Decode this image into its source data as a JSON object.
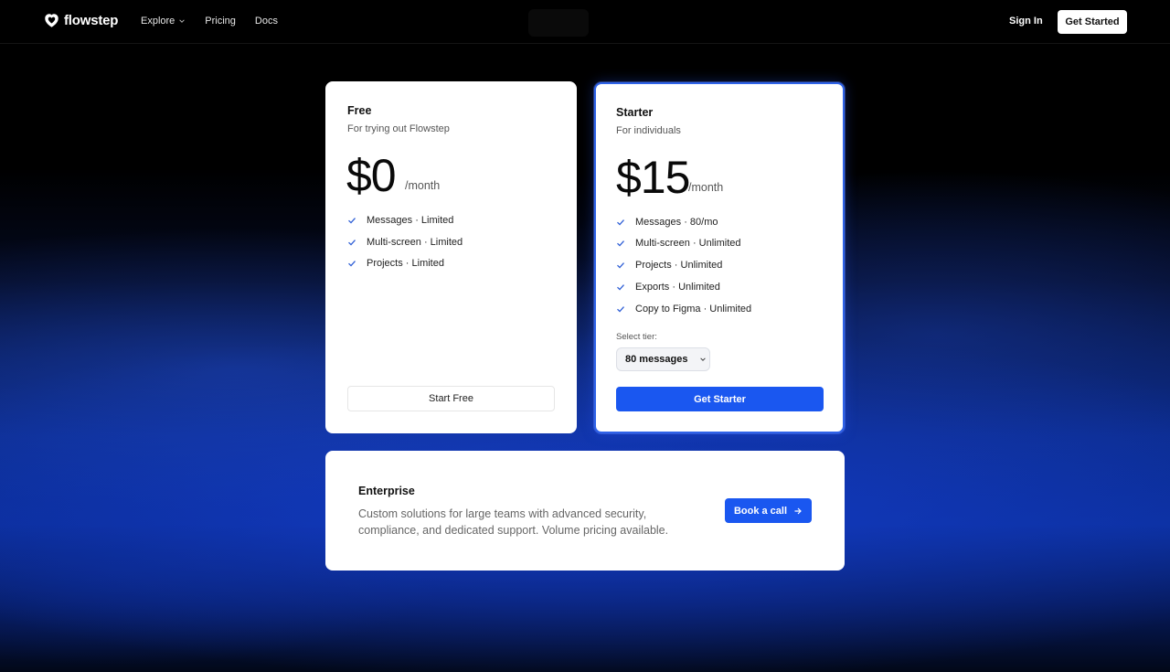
{
  "brand": {
    "name": "flowstep",
    "icon": "heart-shield-icon"
  },
  "nav": {
    "links": [
      {
        "label": "Explore",
        "has_dropdown": true
      },
      {
        "label": "Pricing"
      },
      {
        "label": "Docs"
      }
    ],
    "sign_in": "Sign In",
    "get_started": "Get Started"
  },
  "plans": {
    "free": {
      "name": "Free",
      "description": "For trying out Flowstep",
      "price": "$0",
      "period": "/month",
      "features": [
        "Messages · Limited",
        "Multi-screen · Limited",
        "Projects · Limited"
      ],
      "cta": "Start Free"
    },
    "starter": {
      "name": "Starter",
      "description": "For individuals",
      "price": "$15",
      "period": "/month",
      "features": [
        "Messages · 80/mo",
        "Multi-screen · Unlimited",
        "Projects · Unlimited",
        "Exports · Unlimited",
        "Copy to Figma · Unlimited"
      ],
      "tier_label": "Select tier:",
      "tier_value": "80 messages",
      "cta": "Get Starter"
    }
  },
  "enterprise": {
    "name": "Enterprise",
    "description": "Custom solutions for large teams with advanced security, compliance, and dedicated support. Volume pricing available.",
    "cta": "Book a call"
  },
  "colors": {
    "accent": "#1a57f0",
    "check": "#2f5fd6",
    "background": "#000000"
  }
}
